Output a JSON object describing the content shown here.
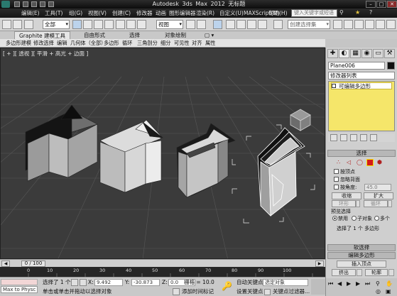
{
  "window": {
    "title": "Autodesk 3ds Max  2012       无标题",
    "minimize": "–",
    "maximize": "□",
    "close": "✕"
  },
  "menubar": {
    "items": [
      "编辑(E)",
      "工具(T)",
      "组(G)",
      "视图(V)",
      "创建(C)",
      "修改器",
      "动画",
      "图形编辑器",
      "渲染(R)",
      "自定义(U)",
      "MAXScript(M)",
      "帮助(H)"
    ],
    "search_placeholder": "键入关键字或短语"
  },
  "toolbar": {
    "selection_filter": "全部",
    "reference_coord": "视图",
    "named_selection_placeholder": "创建选择集"
  },
  "ribbon": {
    "tabs": [
      "Graphite 建模工具",
      "自由形式",
      "选择",
      "对象绘制"
    ],
    "tab_extra": "▢ ▾",
    "panel_items": [
      "多边形建模",
      "修改选择",
      "编辑",
      "几何体（全部）",
      "多边形",
      "循环",
      "三角剖分",
      "细分",
      "可见性",
      "对齐",
      "属性"
    ]
  },
  "viewport": {
    "label": "[ + ][ 透视 ][ 平滑 + 高光 + 边面 ]"
  },
  "command_panel": {
    "tab_icons": [
      "✚",
      "◐",
      "▦",
      "◉",
      "▭",
      "⚒"
    ],
    "object_name": "Plane006",
    "object_color": "#101010",
    "modifier_list": "修改器列表",
    "stack_item": "可编辑多边形",
    "selection_header": "选择",
    "by_vertex": "按顶点",
    "ignore_backfacing": "忽略背面",
    "by_angle": "按角度:",
    "angle_value": "45.0",
    "shrink": "收缩",
    "grow": "扩大",
    "ring": "环形",
    "loop": "循环",
    "preview_selection": "预览选择",
    "preview_options": [
      "禁用",
      "子对象",
      "多个"
    ],
    "selection_info": "选择了 1 个 多边形",
    "soft_selection": "软选择",
    "edit_polygons": "编辑多边形",
    "insert_vertex": "插入顶点",
    "extrude": "挤出",
    "outline": "轮廓"
  },
  "timeslider": {
    "position": "0 / 100",
    "value": 0
  },
  "trackbar": {
    "ticks": [
      "0",
      "10",
      "20",
      "30",
      "40",
      "50",
      "60",
      "70",
      "80",
      "90",
      "100"
    ]
  },
  "statusbar": {
    "maxscript_prompt": "Max to Physc ▲",
    "selected_count": "选择了 1 个",
    "prompt": "单击或单击并拖动以选择对象",
    "x_label": "X:",
    "x_value": "9.492",
    "y_label": "Y:",
    "y_value": "-30.873",
    "z_label": "Z:",
    "z_value": "0.0",
    "grid": "栅格 = 10.0",
    "add_time_tag": "添加时间标记",
    "auto_key": "自动关键点",
    "set_key": "设置关键点",
    "key_mode": "选定对象",
    "key_filters": "关键点过滤器..."
  },
  "colors": {
    "viewport_bg": "#3b3b3b",
    "grid_line": "#5a5a5a",
    "selection_white": "#ffffff",
    "stack_yellow": "#f5e66a"
  }
}
